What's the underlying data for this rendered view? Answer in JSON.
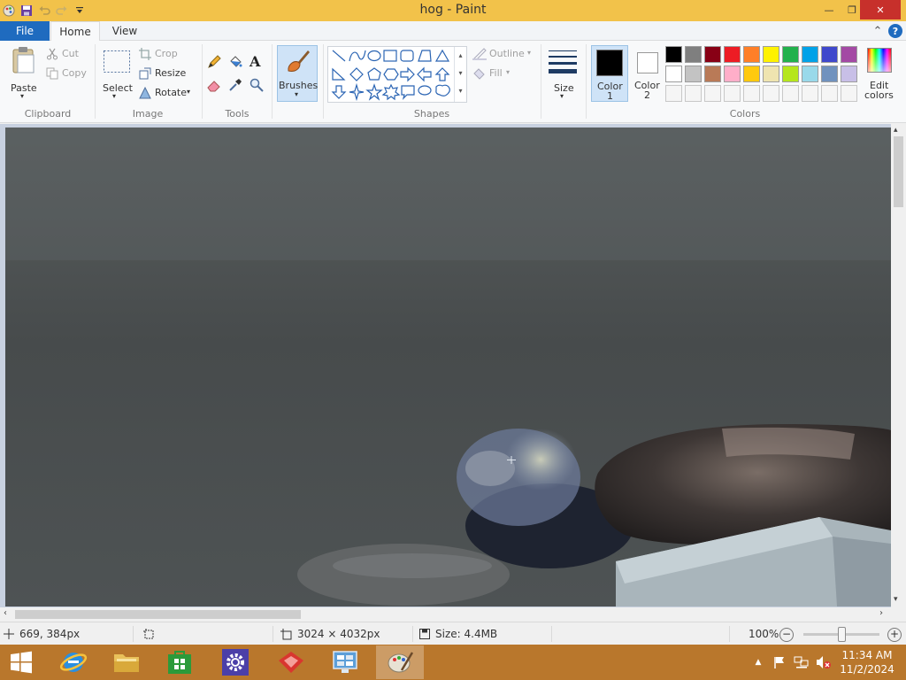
{
  "window": {
    "title": "hog - Paint",
    "minimize_glyph": "—",
    "maximize_glyph": "❐",
    "close_glyph": "✕"
  },
  "tabs": [
    {
      "label": "File"
    },
    {
      "label": "Home"
    },
    {
      "label": "View"
    }
  ],
  "ribbon_controls": {
    "collapse_glyph": "⌃",
    "help_glyph": "?"
  },
  "clipboard": {
    "paste": "Paste",
    "cut": "Cut",
    "copy": "Copy",
    "group": "Clipboard"
  },
  "image_group": {
    "select": "Select",
    "crop": "Crop",
    "resize": "Resize",
    "rotate": "Rotate",
    "group": "Image"
  },
  "tools": {
    "group": "Tools",
    "text_tool_glyph": "A"
  },
  "brushes": {
    "label": "Brushes"
  },
  "shapes": {
    "outline": "Outline",
    "fill": "Fill",
    "group": "Shapes"
  },
  "size": {
    "label": "Size"
  },
  "colors": {
    "color1_label": "Color",
    "color1_number": "1",
    "color2_label": "Color",
    "color2_number": "2",
    "edit_line1": "Edit",
    "edit_line2": "colors",
    "group": "Colors",
    "color1_value": "#000000",
    "color2_value": "#ffffff",
    "palette_row1": [
      "#000000",
      "#7f7f7f",
      "#880015",
      "#ed1c24",
      "#ff7f27",
      "#fff200",
      "#22b14c",
      "#00a2e8",
      "#3f48cc",
      "#a349a4"
    ],
    "palette_row2": [
      "#ffffff",
      "#c3c3c3",
      "#b97a57",
      "#ffaec9",
      "#ffc90e",
      "#efe4b0",
      "#b5e61d",
      "#99d9ea",
      "#7092be",
      "#c8bfe7"
    ],
    "palette_row3": [
      "#f5f5f5",
      "#f5f5f5",
      "#f5f5f5",
      "#f5f5f5",
      "#f5f5f5",
      "#f5f5f5",
      "#f5f5f5",
      "#f5f5f5",
      "#f5f5f5",
      "#f5f5f5"
    ]
  },
  "status": {
    "cursor_position": "669, 384px",
    "image_dimensions": "3024 × 4032px",
    "file_size": "Size: 4.4MB",
    "zoom": "100%",
    "zoom_out": "−",
    "zoom_in": "+",
    "zoom_level": 0.5
  },
  "taskbar": {
    "time": "11:34 AM",
    "date": "11/2/2024",
    "tray_up": "▲"
  }
}
